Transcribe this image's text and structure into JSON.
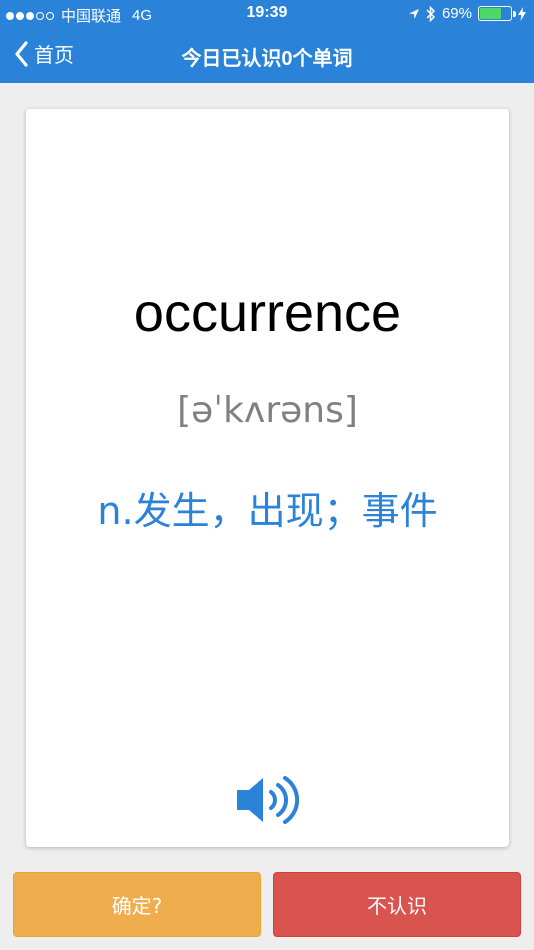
{
  "status_bar": {
    "carrier": "中国联通",
    "network": "4G",
    "time": "19:39",
    "battery_percent": "69%",
    "battery_level": 0.69
  },
  "nav": {
    "back_label": "首页",
    "title": "今日已认识0个单词"
  },
  "card": {
    "word": "occurrence",
    "phonetic": "[əˈkʌrəns]",
    "meaning": "n.发生，出现；事件"
  },
  "buttons": {
    "confirm_label": "确定?",
    "unknown_label": "不认识"
  },
  "colors": {
    "primary": "#2b83d9",
    "confirm": "#f0ad4e",
    "unknown": "#d9534f"
  }
}
